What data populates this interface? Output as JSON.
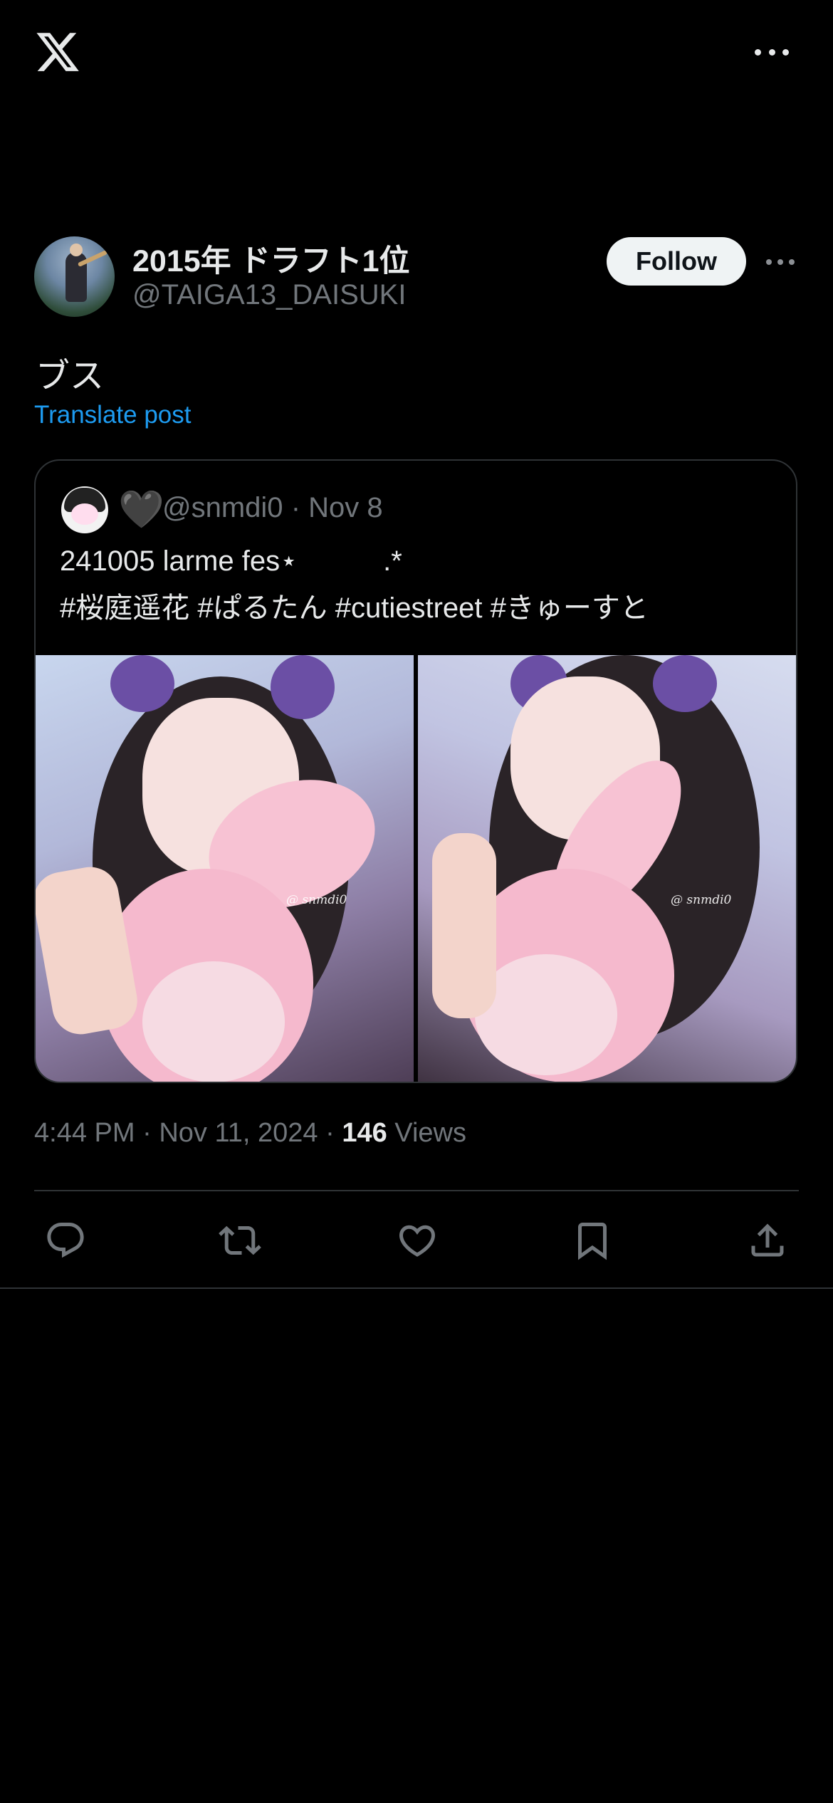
{
  "header": {
    "display_name": "2015年 ドラフト1位",
    "handle": "@TAIGA13_DAISUKI",
    "follow_label": "Follow"
  },
  "post": {
    "text": "ブス",
    "translate_label": "Translate post"
  },
  "quote": {
    "heart": "🖤",
    "handle": "@snmdi0",
    "date": "Nov 8",
    "line1": "241005 larme fes⋆",
    "line1_suffix": ".*",
    "line2": "#桜庭遥花 #ぱるたん #cutiestreet #きゅーすと",
    "watermark_left": "@ snmdi0",
    "watermark_right": "@ snmdi0"
  },
  "meta": {
    "time": "4:44 PM",
    "date": "Nov 11, 2024",
    "views_count": "146",
    "views_label": "Views"
  },
  "icons": [
    "x-logo-icon",
    "more-icon",
    "reply-icon",
    "repost-icon",
    "like-icon",
    "bookmark-icon",
    "share-icon"
  ],
  "colors": {
    "background": "#000000",
    "accent": "#1d9bf0",
    "muted": "#71767b",
    "text": "#e7e9ea"
  }
}
